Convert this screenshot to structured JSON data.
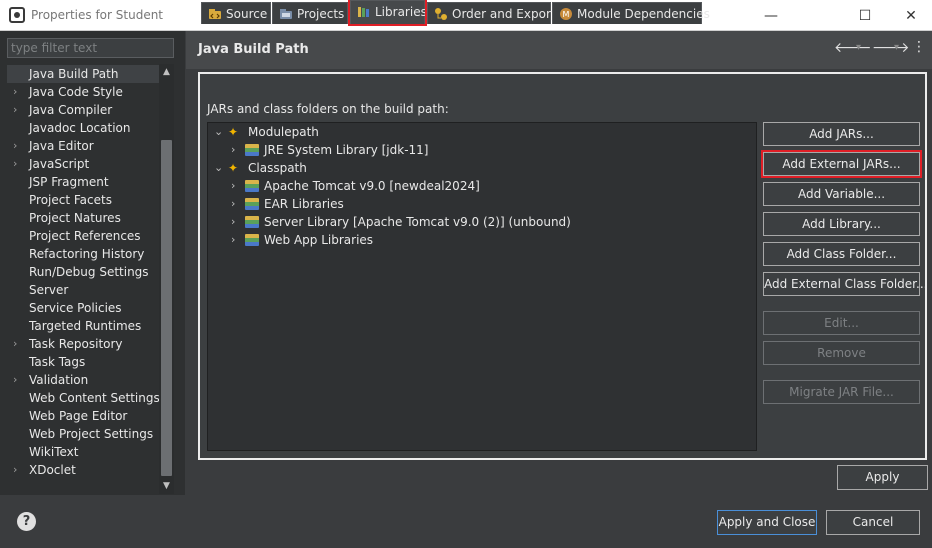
{
  "window": {
    "title": "Properties for Student",
    "minimize": "—",
    "maximize": "☐",
    "close": "✕"
  },
  "filter": {
    "placeholder": "type filter text"
  },
  "sidebar": {
    "items": [
      {
        "label": "Java Build Path",
        "chevron": "",
        "selected": true
      },
      {
        "label": "Java Code Style",
        "chevron": "›"
      },
      {
        "label": "Java Compiler",
        "chevron": "›"
      },
      {
        "label": "Javadoc Location",
        "chevron": ""
      },
      {
        "label": "Java Editor",
        "chevron": "›"
      },
      {
        "label": "JavaScript",
        "chevron": "›"
      },
      {
        "label": "JSP Fragment",
        "chevron": ""
      },
      {
        "label": "Project Facets",
        "chevron": ""
      },
      {
        "label": "Project Natures",
        "chevron": ""
      },
      {
        "label": "Project References",
        "chevron": ""
      },
      {
        "label": "Refactoring History",
        "chevron": ""
      },
      {
        "label": "Run/Debug Settings",
        "chevron": ""
      },
      {
        "label": "Server",
        "chevron": ""
      },
      {
        "label": "Service Policies",
        "chevron": ""
      },
      {
        "label": "Targeted Runtimes",
        "chevron": ""
      },
      {
        "label": "Task Repository",
        "chevron": "›"
      },
      {
        "label": "Task Tags",
        "chevron": ""
      },
      {
        "label": "Validation",
        "chevron": "›"
      },
      {
        "label": "Web Content Settings",
        "chevron": ""
      },
      {
        "label": "Web Page Editor",
        "chevron": ""
      },
      {
        "label": "Web Project Settings",
        "chevron": ""
      },
      {
        "label": "WikiText",
        "chevron": ""
      },
      {
        "label": "XDoclet",
        "chevron": "›"
      }
    ]
  },
  "header": {
    "title": "Java Build Path",
    "back_icon": "🡐",
    "forward_icon": "🡒",
    "menu_icon": "⋮",
    "dropdown_icon": "▾"
  },
  "tabs": [
    {
      "label": "Source",
      "icon": "source-icon"
    },
    {
      "label": "Projects",
      "icon": "projects-icon"
    },
    {
      "label": "Libraries",
      "icon": "libraries-icon",
      "active": true
    },
    {
      "label": "Order and Export",
      "icon": "order-export-icon"
    },
    {
      "label": "Module Dependencies",
      "icon": "module-dependencies-icon"
    }
  ],
  "main": {
    "subhead": "JARs and class folders on the build path:",
    "tree": [
      {
        "label": "Modulepath",
        "level": 0,
        "expanded": true,
        "chevron": "⌄"
      },
      {
        "label": "JRE System Library [jdk-11]",
        "level": 1,
        "chevron": "›"
      },
      {
        "label": "Classpath",
        "level": 0,
        "expanded": true,
        "chevron": "⌄"
      },
      {
        "label": "Apache Tomcat v9.0 [newdeal2024]",
        "level": 1,
        "chevron": "›"
      },
      {
        "label": "EAR Libraries",
        "level": 1,
        "chevron": "›"
      },
      {
        "label": "Server Library [Apache Tomcat v9.0 (2)] (unbound)",
        "level": 1,
        "chevron": "›"
      },
      {
        "label": "Web App Libraries",
        "level": 1,
        "chevron": "›"
      }
    ],
    "buttons": [
      {
        "label": "Add JARs...",
        "enabled": true
      },
      {
        "label": "Add External JARs...",
        "enabled": true,
        "highlighted": true
      },
      {
        "label": "Add Variable...",
        "enabled": true
      },
      {
        "label": "Add Library...",
        "enabled": true
      },
      {
        "label": "Add Class Folder...",
        "enabled": true
      },
      {
        "label": "Add External Class Folder...",
        "enabled": true
      },
      {
        "label": "Edit...",
        "enabled": false
      },
      {
        "label": "Remove",
        "enabled": false
      },
      {
        "label": "Migrate JAR File...",
        "enabled": false
      }
    ],
    "apply_label": "Apply"
  },
  "footer": {
    "help_icon": "?",
    "apply_close_label": "Apply and Close",
    "cancel_label": "Cancel"
  },
  "colors": {
    "highlight": "#e01e26",
    "default_button_border": "#4a8fd8"
  }
}
